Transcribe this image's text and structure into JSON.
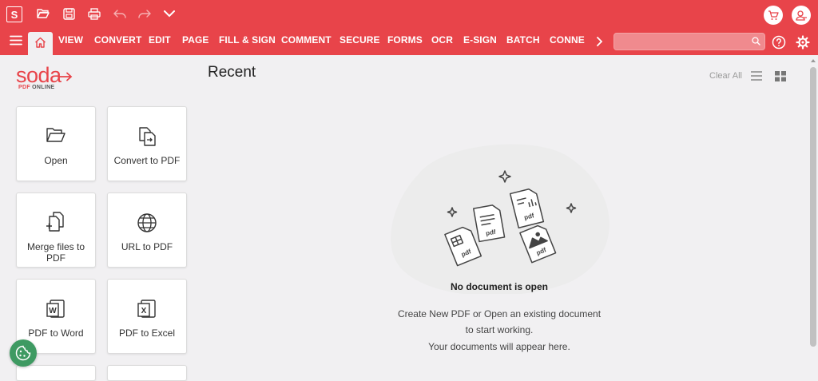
{
  "app": {
    "logo_letter": "S"
  },
  "menu": [
    "VIEW",
    "CONVERT",
    "EDIT",
    "PAGE",
    "FILL & SIGN",
    "COMMENT",
    "SECURE",
    "FORMS",
    "OCR",
    "E-SIGN",
    "BATCH",
    "CONNEC"
  ],
  "search": {
    "placeholder": ""
  },
  "brand": {
    "word": "soda",
    "pdf": "PDF",
    "online": " ONLINE",
    "color": "#e8444a"
  },
  "quick_actions": [
    {
      "label": "Open",
      "icon": "folder-open-icon"
    },
    {
      "label": "Convert to PDF",
      "icon": "convert-doc-icon"
    },
    {
      "label": "Merge files to PDF",
      "icon": "merge-files-icon"
    },
    {
      "label": "URL to PDF",
      "icon": "globe-icon"
    },
    {
      "label": "PDF to Word",
      "icon": "word-file-icon"
    },
    {
      "label": "PDF to Excel",
      "icon": "excel-file-icon"
    }
  ],
  "recent": {
    "title": "Recent",
    "clear_all": "Clear All",
    "empty_title": "No document is open",
    "empty_lines": [
      "Create New PDF or Open an existing document",
      "to start working.",
      "Your documents will appear here."
    ],
    "illustration_text": "pdf"
  }
}
